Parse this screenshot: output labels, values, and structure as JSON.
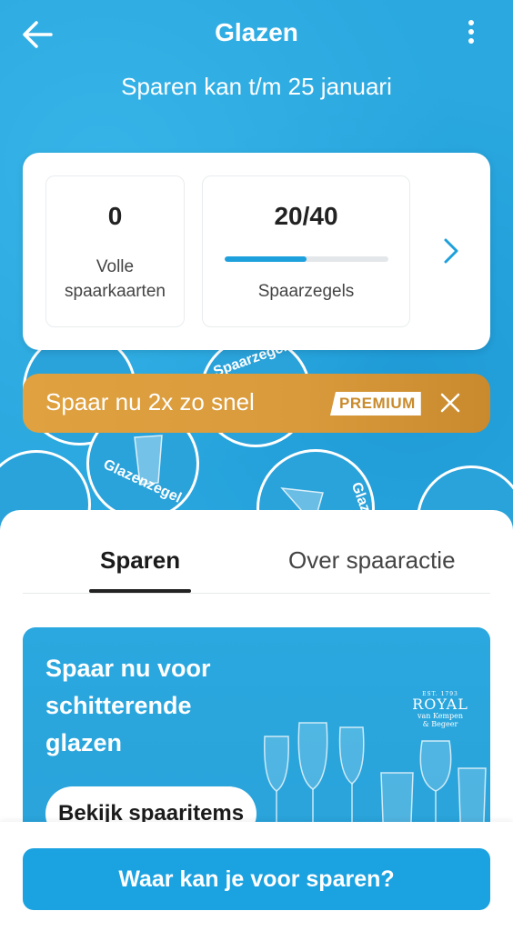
{
  "header": {
    "title": "Glazen",
    "subtitle": "Sparen kan t/m 25 januari",
    "back_icon": "arrow-left-icon",
    "more_icon": "more-vertical-icon"
  },
  "summary": {
    "full_cards_value": "0",
    "full_cards_label_1": "Volle",
    "full_cards_label_2": "spaarkaarten",
    "stamps_value": "20/40",
    "stamps_label": "Spaarzegels",
    "stamps_progress": 0.5,
    "chevron_icon": "chevron-right-icon"
  },
  "coins": {
    "label_1": "Spaarzegel",
    "label_2": "Glazenzegel",
    "label_3": "Glazen"
  },
  "premium_banner": {
    "text": "Spaar nu 2x zo snel",
    "badge": "PREMIUM",
    "close_icon": "close-icon"
  },
  "tabs": [
    {
      "label": "Sparen",
      "active": true
    },
    {
      "label": "Over spaaractie",
      "active": false
    }
  ],
  "promo": {
    "line_1": "Spaar nu voor",
    "line_2": "schitterende",
    "line_3": "glazen",
    "button_label": "Bekijk spaaritems",
    "brand_small": "EST. 1793",
    "brand_big": "ROYAL",
    "brand_sub_1": "van Kempen",
    "brand_sub_2": "& Begeer"
  },
  "cta": {
    "label": "Waar kan je voor sparen?"
  },
  "colors": {
    "primary": "#1ba2e0",
    "background": "#2aa8df",
    "premium": "#d89a3b"
  }
}
